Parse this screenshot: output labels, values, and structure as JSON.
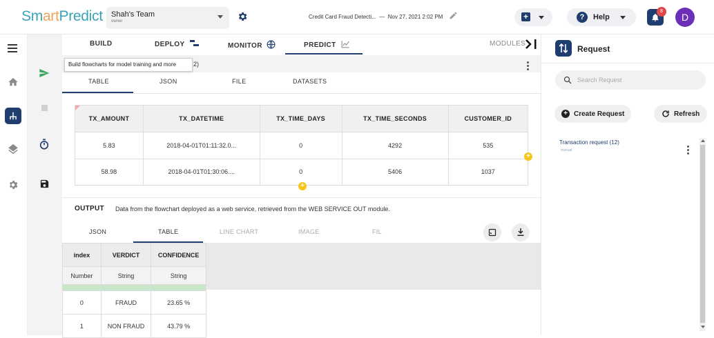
{
  "header": {
    "logo": {
      "part1": "Sm",
      "part2": "art",
      "part3": "Predict"
    },
    "team": {
      "name": "Shah's Team",
      "role": "owner"
    },
    "project": {
      "title": "Credit Card Fraud Detecti...",
      "separator": "—",
      "datetime": "Nov 27, 2021 2:02 PM"
    },
    "help_label": "Help",
    "notification_count": "8",
    "avatar_letter": "D"
  },
  "nav": {
    "tabs": [
      {
        "label": "BUILD"
      },
      {
        "label": "DEPLOY"
      },
      {
        "label": "MONITOR"
      },
      {
        "label": "PREDICT"
      },
      {
        "label": "MODULES"
      }
    ],
    "active": "PREDICT",
    "tooltip": "Build flowcharts for model training and more"
  },
  "request_bar": {
    "suffix": "2)"
  },
  "input_tabs": [
    {
      "label": "TABLE"
    },
    {
      "label": "JSON"
    },
    {
      "label": "FILE"
    },
    {
      "label": "DATASETS"
    }
  ],
  "input_table": {
    "columns": [
      "TX_AMOUNT",
      "TX_DATETIME",
      "TX_TIME_DAYS",
      "TX_TIME_SECONDS",
      "CUSTOMER_ID"
    ],
    "rows": [
      [
        "5.83",
        "2018-04-01T01:11:32.0...",
        "0",
        "4292",
        "535"
      ],
      [
        "58.98",
        "2018-04-01T01:30:06....",
        "0",
        "5406",
        "1037"
      ]
    ]
  },
  "output": {
    "title": "OUTPUT",
    "description": "Data from the flowchart deployed as a web service, retrieved from the WEB SERVICE OUT module.",
    "tabs": [
      {
        "label": "JSON"
      },
      {
        "label": "TABLE"
      },
      {
        "label": "LINE CHART"
      },
      {
        "label": "IMAGE"
      },
      {
        "label": "FIL"
      }
    ],
    "active_tab": "TABLE",
    "table": {
      "columns": [
        "index",
        "VERDICT",
        "CONFIDENCE"
      ],
      "types": [
        "Number",
        "String",
        "String"
      ],
      "rows": [
        [
          "0",
          "FRAUD",
          "23.65 %"
        ],
        [
          "1",
          "NON FRAUD",
          "43.79 %"
        ]
      ]
    }
  },
  "right_panel": {
    "title": "Request",
    "search_placeholder": "Search Request",
    "create_label": "Create Request",
    "refresh_label": "Refresh",
    "requests": [
      {
        "name": "Transaction request (12)",
        "sub": "manual"
      }
    ]
  },
  "colors": {
    "brand": "#1f3d6e",
    "accent": "#f5c518",
    "logo_blue": "#3aa3b8",
    "logo_orange": "#f0a35a",
    "avatar": "#6b2fb8",
    "badge": "#e04848"
  }
}
